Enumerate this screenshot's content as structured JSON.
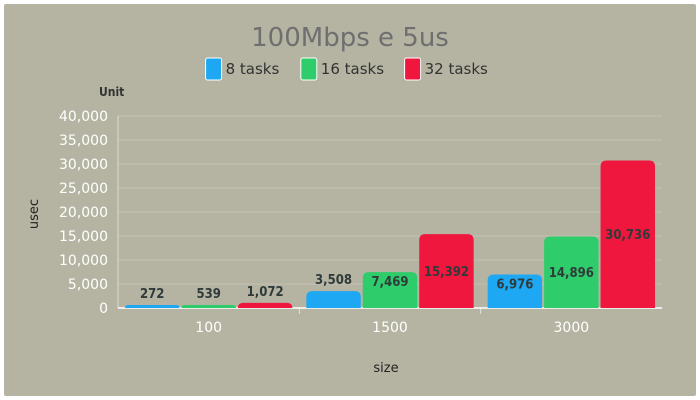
{
  "chart_data": {
    "type": "bar",
    "title": "100Mbps e 5us",
    "unit_label": "Unit",
    "xlabel": "size",
    "ylabel": "usec",
    "categories": [
      "100",
      "1500",
      "3000"
    ],
    "ylim": [
      0,
      40000
    ],
    "yticks": [
      0,
      5000,
      10000,
      15000,
      20000,
      25000,
      30000,
      35000,
      40000
    ],
    "ytick_labels": [
      "0",
      "5,000",
      "10,000",
      "15,000",
      "20,000",
      "25,000",
      "30,000",
      "35,000",
      "40,000"
    ],
    "grid": true,
    "legend_position": "top",
    "series": [
      {
        "name": "8 tasks",
        "color": "#1ea7f2",
        "values": [
          272,
          3508,
          6976
        ],
        "labels": [
          "272",
          "3,508",
          "6,976"
        ]
      },
      {
        "name": "16 tasks",
        "color": "#2ecc6a",
        "values": [
          539,
          7469,
          14896
        ],
        "labels": [
          "539",
          "7,469",
          "14,896"
        ]
      },
      {
        "name": "32 tasks",
        "color": "#f0173f",
        "values": [
          1072,
          15392,
          30736
        ],
        "labels": [
          "1,072",
          "15,392",
          "30,736"
        ]
      }
    ]
  }
}
